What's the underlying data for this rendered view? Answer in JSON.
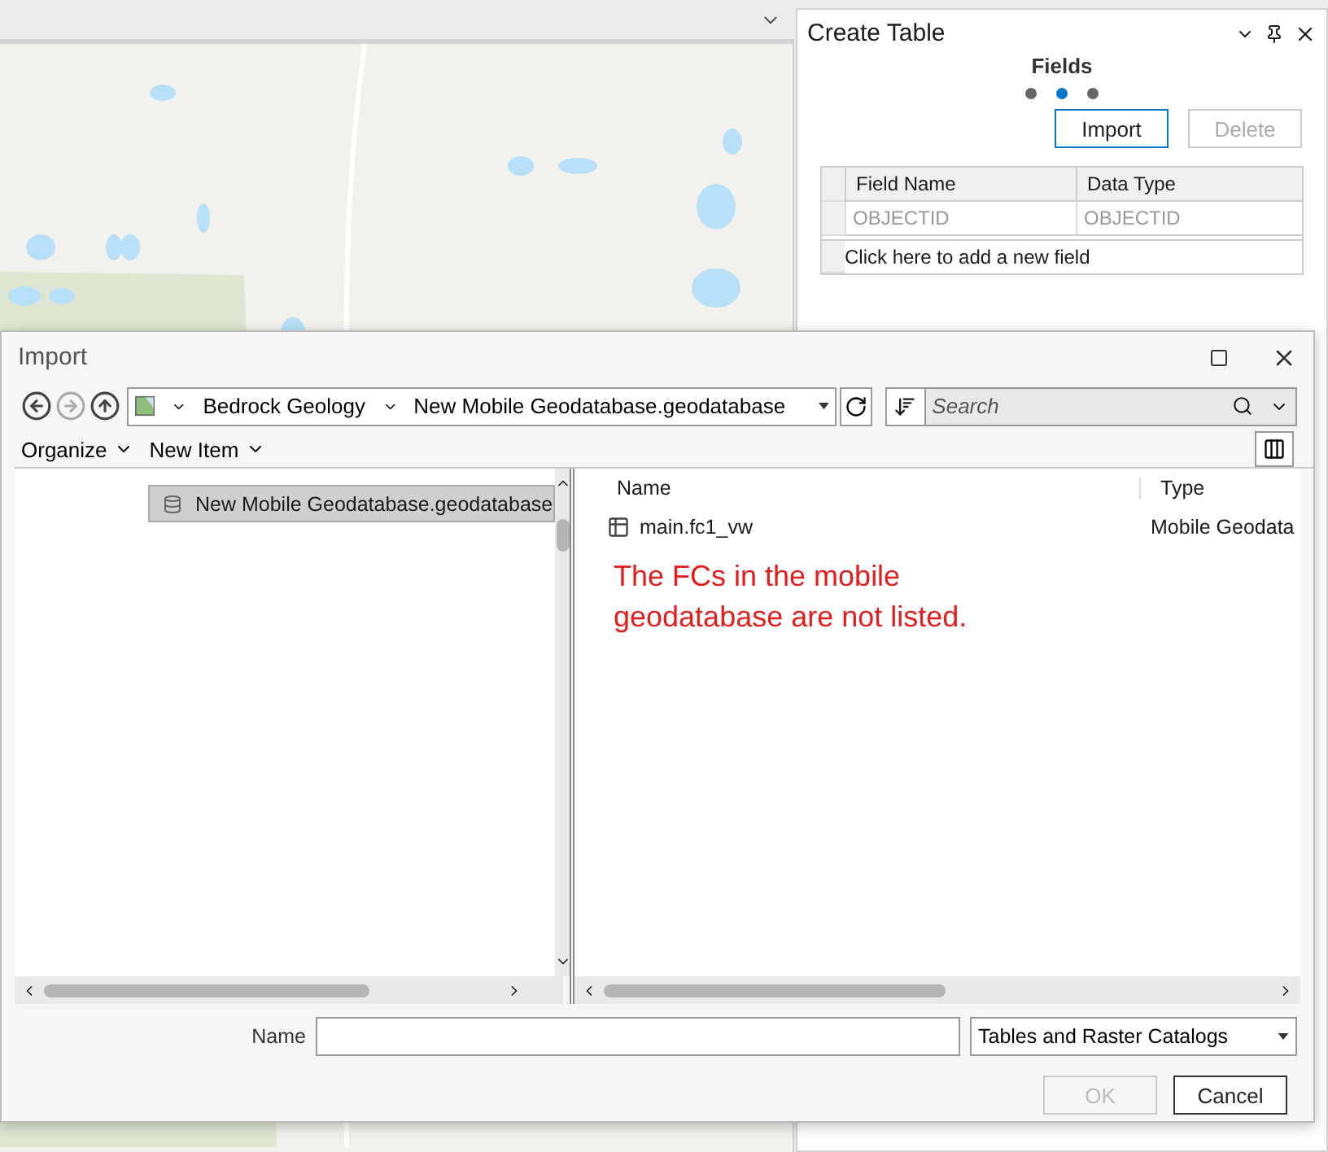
{
  "create_table": {
    "title": "Create Table",
    "step_title": "Fields",
    "steps": [
      {
        "selected": false
      },
      {
        "selected": true
      },
      {
        "selected": false
      }
    ],
    "buttons": [
      {
        "label": "Import",
        "disabled": false
      },
      {
        "label": "Delete",
        "disabled": true
      }
    ],
    "table": {
      "columns": [
        "Field Name",
        "Data Type"
      ],
      "rows": [
        [
          "OBJECTID",
          "OBJECTID"
        ]
      ],
      "add_row": "Click here to add a new field"
    }
  },
  "dialog": {
    "title": "Import",
    "breadcrumb": [
      "Bedrock Geology",
      "New Mobile Geodatabase.geodatabase"
    ],
    "search": {
      "placeholder": "Search"
    },
    "toolbar": [
      "Organize",
      "New Item"
    ],
    "tree": [
      {
        "label": "New Mobile Geodatabase.geodatabase",
        "selected": true
      }
    ],
    "columns": [
      "Name",
      "Type"
    ],
    "items": [
      {
        "name": "main.fc1_vw",
        "type": "Mobile Geodata"
      }
    ],
    "note": "The FCs in the mobile geodatabase are not listed.",
    "name_label": "Name",
    "filter": "Tables and Raster Catalogs",
    "buttons": [
      {
        "label": "OK",
        "disabled": true
      },
      {
        "label": "Cancel",
        "disabled": false
      }
    ]
  }
}
